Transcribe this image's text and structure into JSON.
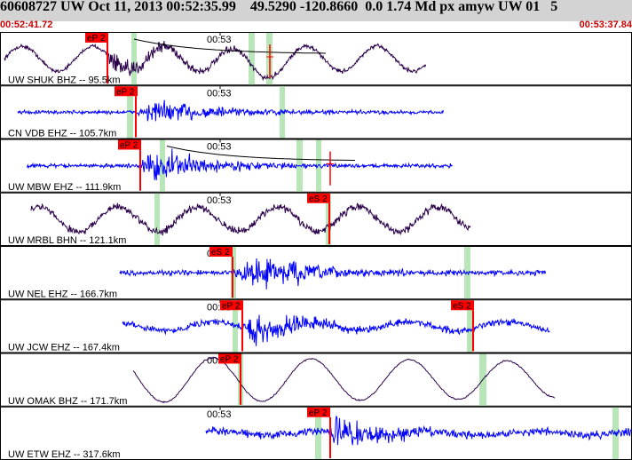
{
  "header": {
    "title": "60608727 UW Oct 11, 2013 00:52:35.99    49.5290 -120.8660  0.0 1.74 Md px amyw UW 01   5",
    "start_time": "00:52:41.72",
    "end_time": "00:53:37.84"
  },
  "colors": {
    "header_bg": "#d3d3d3",
    "trace_blue": "#0000ff",
    "trace_purple": "#2a004a",
    "pick_red": "#ff0000",
    "window_green": "#b8e6b8",
    "time_red": "#cc0000"
  },
  "chart_data": {
    "type": "line",
    "title": "60608727 UW Oct 11, 2013 00:52:35.99    49.5290 -120.8660  0.0 1.74 Md px amyw UW 01   5",
    "x_range_label": [
      "00:52:41.72",
      "00:53:37.84"
    ],
    "time_tick": "00:53",
    "traces": [
      {
        "label": "UW SHUK BHZ -- 95.5km",
        "color": "purple",
        "picks": [
          {
            "label": "eP 2",
            "pos": 0.17
          }
        ],
        "style": "shuk"
      },
      {
        "label": "CN VDB EHZ -- 105.7km",
        "color": "blue",
        "picks": [
          {
            "label": "eP 2",
            "pos": 0.21
          }
        ],
        "style": "vdb"
      },
      {
        "label": "UW MBW EHZ -- 111.9km",
        "color": "blue",
        "picks": [
          {
            "label": "eP 2",
            "pos": 0.22
          }
        ],
        "style": "mbw"
      },
      {
        "label": "UW MRBL BHN -- 121.1km",
        "color": "purple",
        "picks": [
          {
            "label": "eS 2",
            "pos": 0.52
          }
        ],
        "style": "mrbl"
      },
      {
        "label": "UW NEL EHZ -- 166.7km",
        "color": "blue",
        "picks": [
          {
            "label": "eS 2",
            "pos": 0.37
          }
        ],
        "style": "nel"
      },
      {
        "label": "UW JCW EHZ -- 167.4km",
        "color": "blue",
        "picks": [
          {
            "label": "eP 2",
            "pos": 0.38
          },
          {
            "label": "eS 2",
            "pos": 0.75
          }
        ],
        "style": "jcw"
      },
      {
        "label": "UW OMAK BHZ -- 171.7km",
        "color": "purple",
        "picks": [
          {
            "label": "eP 2",
            "pos": 0.38
          }
        ],
        "style": "omak"
      },
      {
        "label": "UW ETW EHZ -- 317.6km",
        "color": "blue",
        "picks": [
          {
            "label": "eP 2",
            "pos": 0.52
          }
        ],
        "style": "etw"
      }
    ]
  }
}
